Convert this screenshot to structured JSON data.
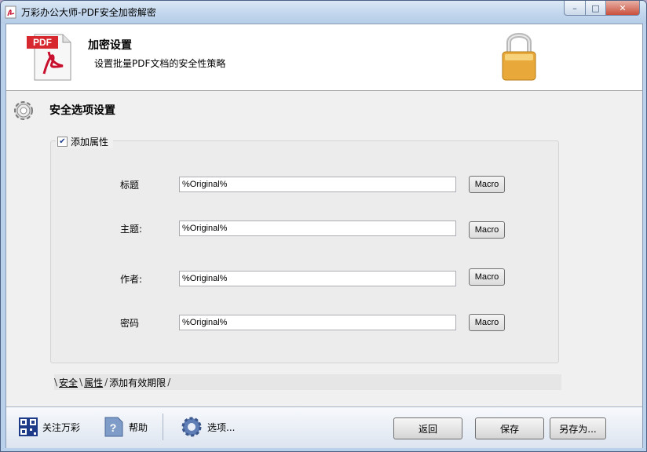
{
  "window": {
    "title": "万彩办公大师-PDF安全加密解密"
  },
  "header": {
    "title": "加密设置",
    "subtitle": "设置批量PDF文档的安全性策略",
    "pdf_icon_text": "PDF"
  },
  "section": {
    "title": "安全选项设置"
  },
  "group": {
    "label": "添加属性",
    "checked": true
  },
  "fields": [
    {
      "label": "标题",
      "value": "%Original%",
      "button": "Macro"
    },
    {
      "label": "主题:",
      "value": "%Original%",
      "button": "Macro"
    },
    {
      "label": "作者:",
      "value": "%Original%",
      "button": "Macro"
    },
    {
      "label": "密码",
      "value": "%Original%",
      "button": "Macro"
    }
  ],
  "tabs": [
    "安全",
    "属性",
    "添加有效期限"
  ],
  "footer": {
    "follow": "关注万彩",
    "help": "帮助",
    "options": "选项...",
    "back": "返回",
    "save": "保存",
    "save_as": "另存为..."
  }
}
